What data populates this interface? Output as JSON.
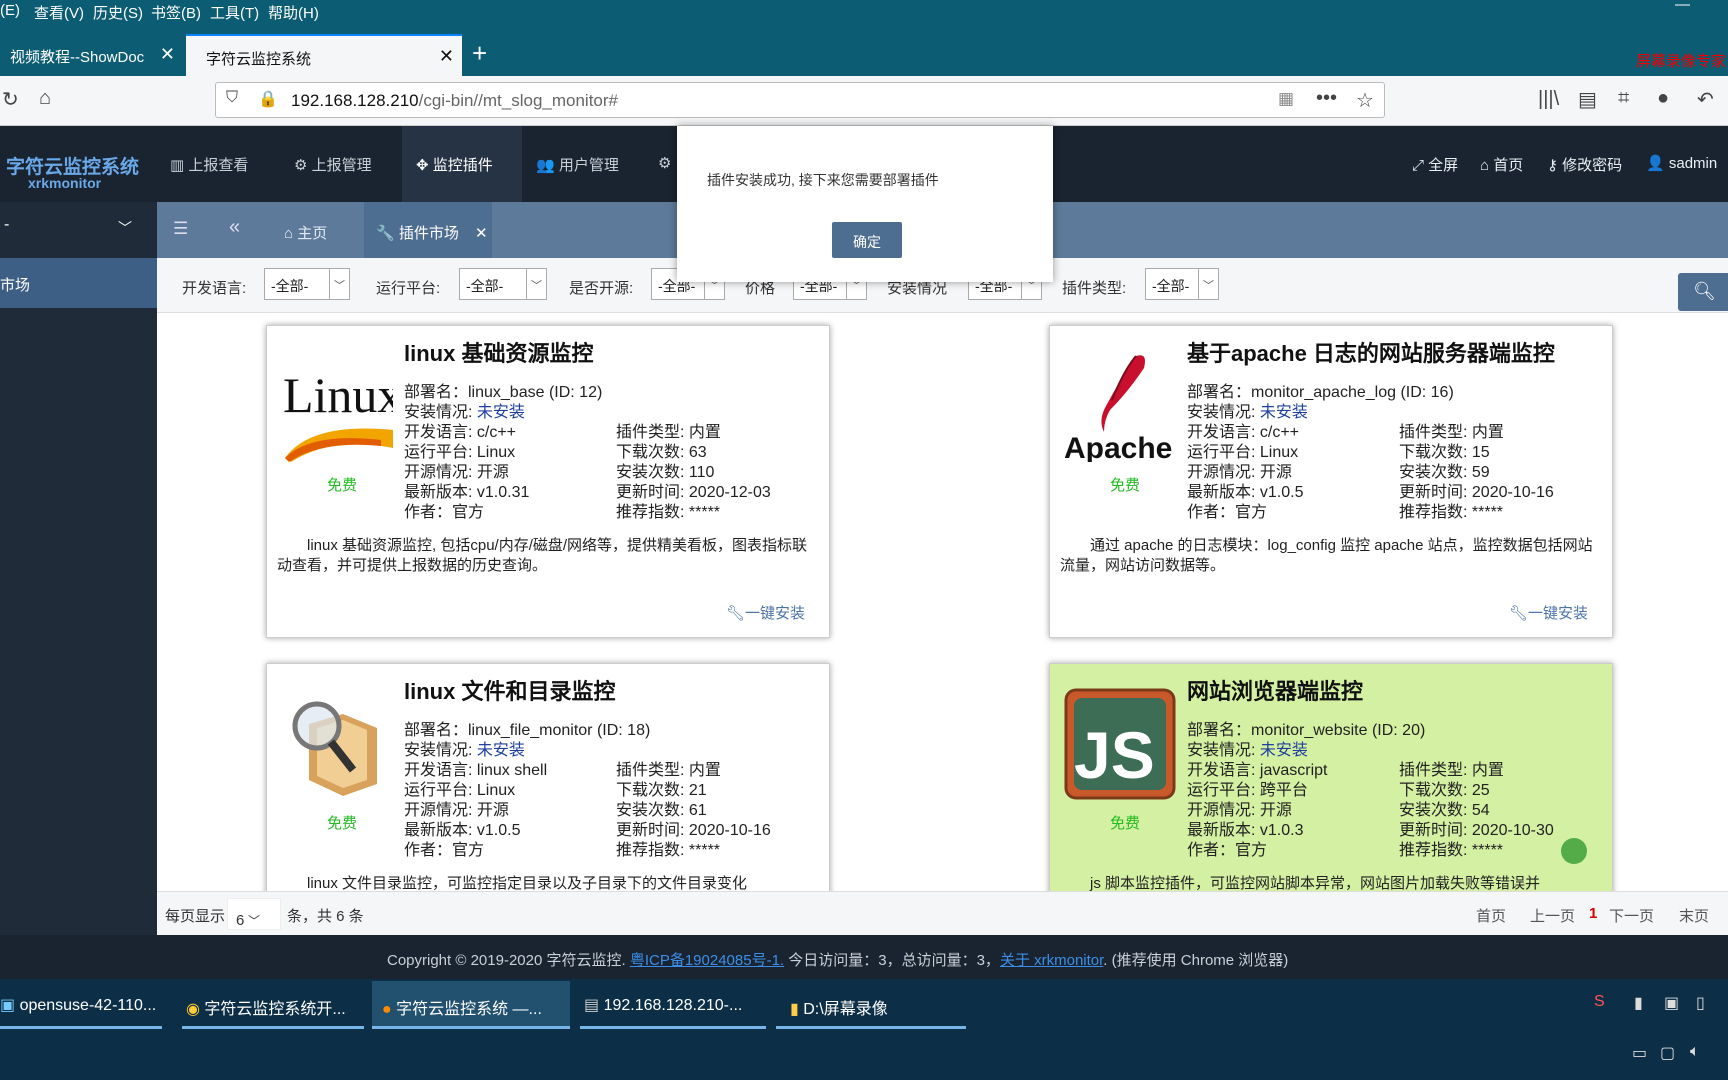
{
  "browser": {
    "menu": [
      "(E)",
      "查看(V)",
      "历史(S)",
      "书签(B)",
      "工具(T)",
      "帮助(H)"
    ],
    "recorder_label": "屏幕录像专家",
    "tabs": [
      {
        "title": "视频教程--ShowDoc"
      },
      {
        "title": "字符云监控系统"
      }
    ],
    "url_host": "192.168.128.210",
    "url_path": "/cgi-bin//mt_slog_monitor#"
  },
  "app": {
    "logo_cn": "字符云监控系统",
    "logo_en": "xrkmonitor",
    "nav": [
      "上报查看",
      "上报管理",
      "监控插件",
      "用户管理"
    ],
    "header_right": [
      "全屏",
      "首页",
      "修改密码",
      "sadmin"
    ],
    "page_tabs": [
      "主页",
      "插件市场"
    ],
    "sidebar_item": "市场"
  },
  "filters": [
    {
      "label": "开发语言:",
      "value": "-全部-"
    },
    {
      "label": "运行平台:",
      "value": "-全部-"
    },
    {
      "label": "是否开源:",
      "value": "-全部-"
    },
    {
      "label": "价格",
      "value": "-全部-"
    },
    {
      "label": "安装情况",
      "value": "-全部-"
    },
    {
      "label": "插件类型:",
      "value": "-全部-"
    }
  ],
  "dialog": {
    "message": "插件安装成功, 接下来您需要部署插件",
    "ok": "确定"
  },
  "cards": [
    {
      "title": "linux 基础资源监控",
      "logo": "Linux",
      "price": "免费",
      "deploy": "部署名：linux_base (ID: 12)",
      "install_label": "安装情况:",
      "install_status": "未安装",
      "lang": "开发语言: c/c++",
      "type": "插件类型: 内置",
      "platform": "运行平台: Linux",
      "downloads": "下载次数: 63",
      "opensource": "开源情况: 开源",
      "installs": "安装次数: 110",
      "version": "最新版本: v1.0.31",
      "updated": "更新时间: 2020-12-03",
      "author": "作者：官方",
      "rating": "推荐指数: *****",
      "desc": "linux 基础资源监控, 包括cpu/内存/磁盘/网络等，提供精美看板，图表指标联动查看，并可提供上报数据的历史查询。",
      "action": "一键安装"
    },
    {
      "title": "基于apache 日志的网站服务器端监控",
      "logo": "Apache",
      "price": "免费",
      "deploy": "部署名：monitor_apache_log (ID: 16)",
      "install_label": "安装情况:",
      "install_status": "未安装",
      "lang": "开发语言: c/c++",
      "type": "插件类型: 内置",
      "platform": "运行平台: Linux",
      "downloads": "下载次数: 15",
      "opensource": "开源情况: 开源",
      "installs": "安装次数: 59",
      "version": "最新版本: v1.0.5",
      "updated": "更新时间: 2020-10-16",
      "author": "作者：官方",
      "rating": "推荐指数: *****",
      "desc": "通过 apache 的日志模块：log_config 监控 apache 站点，监控数据包括网站流量，网站访问数据等。",
      "action": "一键安装"
    },
    {
      "title": "linux 文件和目录监控",
      "logo": "",
      "price": "免费",
      "deploy": "部署名：linux_file_monitor (ID: 18)",
      "install_label": "安装情况:",
      "install_status": "未安装",
      "lang": "开发语言: linux shell",
      "type": "插件类型: 内置",
      "platform": "运行平台: Linux",
      "downloads": "下载次数: 21",
      "opensource": "开源情况: 开源",
      "installs": "安装次数: 61",
      "version": "最新版本: v1.0.5",
      "updated": "更新时间: 2020-10-16",
      "author": "作者：官方",
      "rating": "推荐指数: *****",
      "desc": "linux 文件目录监控，可监控指定目录以及子目录下的文件目录变化",
      "action": ""
    },
    {
      "title": "网站浏览器端监控",
      "logo": "JS",
      "price": "免费",
      "deploy": "部署名：monitor_website (ID: 20)",
      "install_label": "安装情况:",
      "install_status": "未安装",
      "lang": "开发语言: javascript",
      "type": "插件类型: 内置",
      "platform": "运行平台: 跨平台",
      "downloads": "下载次数: 25",
      "opensource": "开源情况: 开源",
      "installs": "安装次数: 54",
      "version": "最新版本: v1.0.3",
      "updated": "更新时间: 2020-10-30",
      "author": "作者：官方",
      "rating": "推荐指数: *****",
      "desc": "js 脚本监控插件，可监控网站脚本异常，网站图片加载失败等错误并",
      "action": ""
    }
  ],
  "pager": {
    "per_page_label": "每页显示",
    "per_page_value": "6",
    "total": "条，共 6 条",
    "first": "首页",
    "prev": "上一页",
    "current": "1",
    "next": "下一页",
    "last": "末页"
  },
  "footer": {
    "copyright": "Copyright © 2019-2020 字符云监控.",
    "icp": "粤ICP备19024085号-1.",
    "visits": "今日访问量：3，总访问量：3，",
    "about": "关于 xrkmonitor",
    "note": ". (推荐使用 Chrome 浏览器)"
  },
  "taskbar": [
    {
      "label": "opensuse-42-110..."
    },
    {
      "label": "字符云监控系统开..."
    },
    {
      "label": "字符云监控系统 —..."
    },
    {
      "label": "192.168.128.210-..."
    },
    {
      "label": "D:\\屏幕录像"
    }
  ],
  "colors": {
    "header": "#1a2430",
    "accent": "#4d6d91",
    "highlight_card": "#d4f0a2",
    "free": "#22bb22"
  }
}
